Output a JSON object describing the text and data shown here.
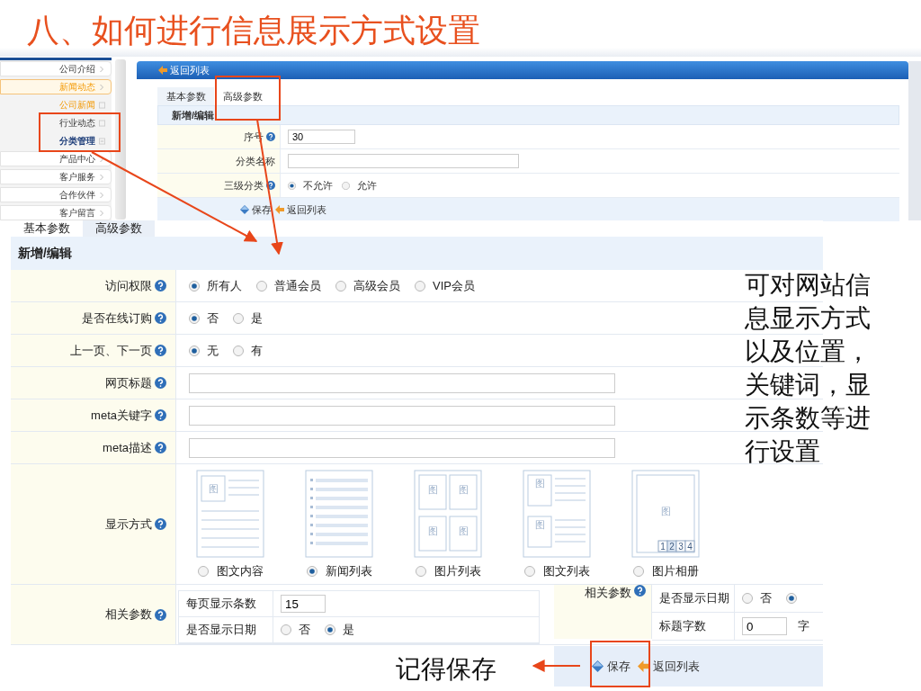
{
  "title": "八、如何进行信息展示方式设置",
  "sidebar": {
    "items": [
      {
        "label": "公司介绍",
        "kind": "menu",
        "selected": false
      },
      {
        "label": "新闻动态",
        "kind": "menu",
        "selected": true
      },
      {
        "label": "公司新闻",
        "kind": "sub",
        "selected": true
      },
      {
        "label": "行业动态",
        "kind": "sub",
        "selected": false
      },
      {
        "label": "分类管理",
        "kind": "manage",
        "selected": false
      },
      {
        "label": "产品中心",
        "kind": "menu",
        "selected": false
      },
      {
        "label": "客户服务",
        "kind": "menu",
        "selected": false
      },
      {
        "label": "合作伙伴",
        "kind": "menu",
        "selected": false
      },
      {
        "label": "客户留言",
        "kind": "menu",
        "selected": false
      }
    ]
  },
  "top_form": {
    "back_link": "返回列表",
    "tabs": [
      {
        "label": "基本参数",
        "selected": false
      },
      {
        "label": "高级参数",
        "selected": true
      }
    ],
    "section": "新增/编辑",
    "rows": [
      {
        "label": "序号",
        "help": true,
        "kind": "text",
        "value": "30"
      },
      {
        "label": "分类名称",
        "help": false,
        "kind": "text"
      },
      {
        "label": "三级分类",
        "help": true,
        "kind": "radio",
        "options": [
          {
            "label": "不允许",
            "selected": true
          },
          {
            "label": "允许",
            "selected": false
          }
        ]
      }
    ],
    "buttons": [
      {
        "label": "保存",
        "kind": "save"
      },
      {
        "label": "返回列表",
        "kind": "back"
      }
    ]
  },
  "main_form": {
    "tabs": [
      {
        "label": "基本参数",
        "selected": true
      },
      {
        "label": "高级参数",
        "selected": false
      }
    ],
    "section": "新增/编辑",
    "rows": [
      {
        "label": "访问权限",
        "help": true,
        "kind": "radio",
        "options": [
          {
            "label": "所有人",
            "selected": true
          },
          {
            "label": "普通会员",
            "selected": false
          },
          {
            "label": "高级会员",
            "selected": false
          },
          {
            "label": "VIP会员",
            "selected": false
          }
        ]
      },
      {
        "label": "是否在线订购",
        "help": true,
        "kind": "radio",
        "options": [
          {
            "label": "否",
            "selected": true
          },
          {
            "label": "是",
            "selected": false
          }
        ]
      },
      {
        "label": "上一页、下一页",
        "help": true,
        "kind": "radio",
        "options": [
          {
            "label": "无",
            "selected": true
          },
          {
            "label": "有",
            "selected": false
          }
        ]
      },
      {
        "label": "网页标题",
        "help": true,
        "kind": "text"
      },
      {
        "label": "meta关键字",
        "help": true,
        "kind": "text"
      },
      {
        "label": "meta描述",
        "help": true,
        "kind": "text"
      },
      {
        "label": "显示方式",
        "help": true,
        "kind": "layouts",
        "options": [
          {
            "label": "图文内容",
            "selected": false,
            "kind": "text-image",
            "marks": [
              "图"
            ]
          },
          {
            "label": "新闻列表",
            "selected": true,
            "kind": "list"
          },
          {
            "label": "图片列表",
            "selected": false,
            "kind": "grid",
            "marks": [
              "图",
              "图",
              "图",
              "图"
            ]
          },
          {
            "label": "图文列表",
            "selected": false,
            "kind": "image-list",
            "marks": [
              "图",
              "图"
            ]
          },
          {
            "label": "图片相册",
            "selected": false,
            "kind": "album",
            "marks": [
              "图"
            ],
            "pages": [
              "1",
              "2",
              "3",
              "4"
            ]
          }
        ]
      },
      {
        "label": "相关参数",
        "help": true,
        "kind": "params",
        "params": [
          {
            "label": "每页显示条数",
            "kind": "text",
            "value": "15"
          },
          {
            "label": "是否显示日期",
            "kind": "radio",
            "options": [
              {
                "label": "否",
                "selected": false
              },
              {
                "label": "是",
                "selected": true
              }
            ]
          }
        ]
      }
    ]
  },
  "side_panel": {
    "label": "相关参数",
    "help": true,
    "rows": [
      {
        "label": "是否显示日期",
        "kind": "radio",
        "options": [
          {
            "label": "否",
            "selected": false
          },
          {
            "selected": true
          }
        ]
      },
      {
        "label": "标题字数",
        "kind": "text",
        "value": "0",
        "suffix": "字"
      }
    ],
    "buttons": [
      {
        "label": "保存",
        "kind": "save"
      },
      {
        "label": "返回列表",
        "kind": "back"
      }
    ]
  },
  "notes": {
    "right": "可对网站信息显示方式以及位置，关键词，显示条数等进行设置",
    "save": "记得保存"
  }
}
